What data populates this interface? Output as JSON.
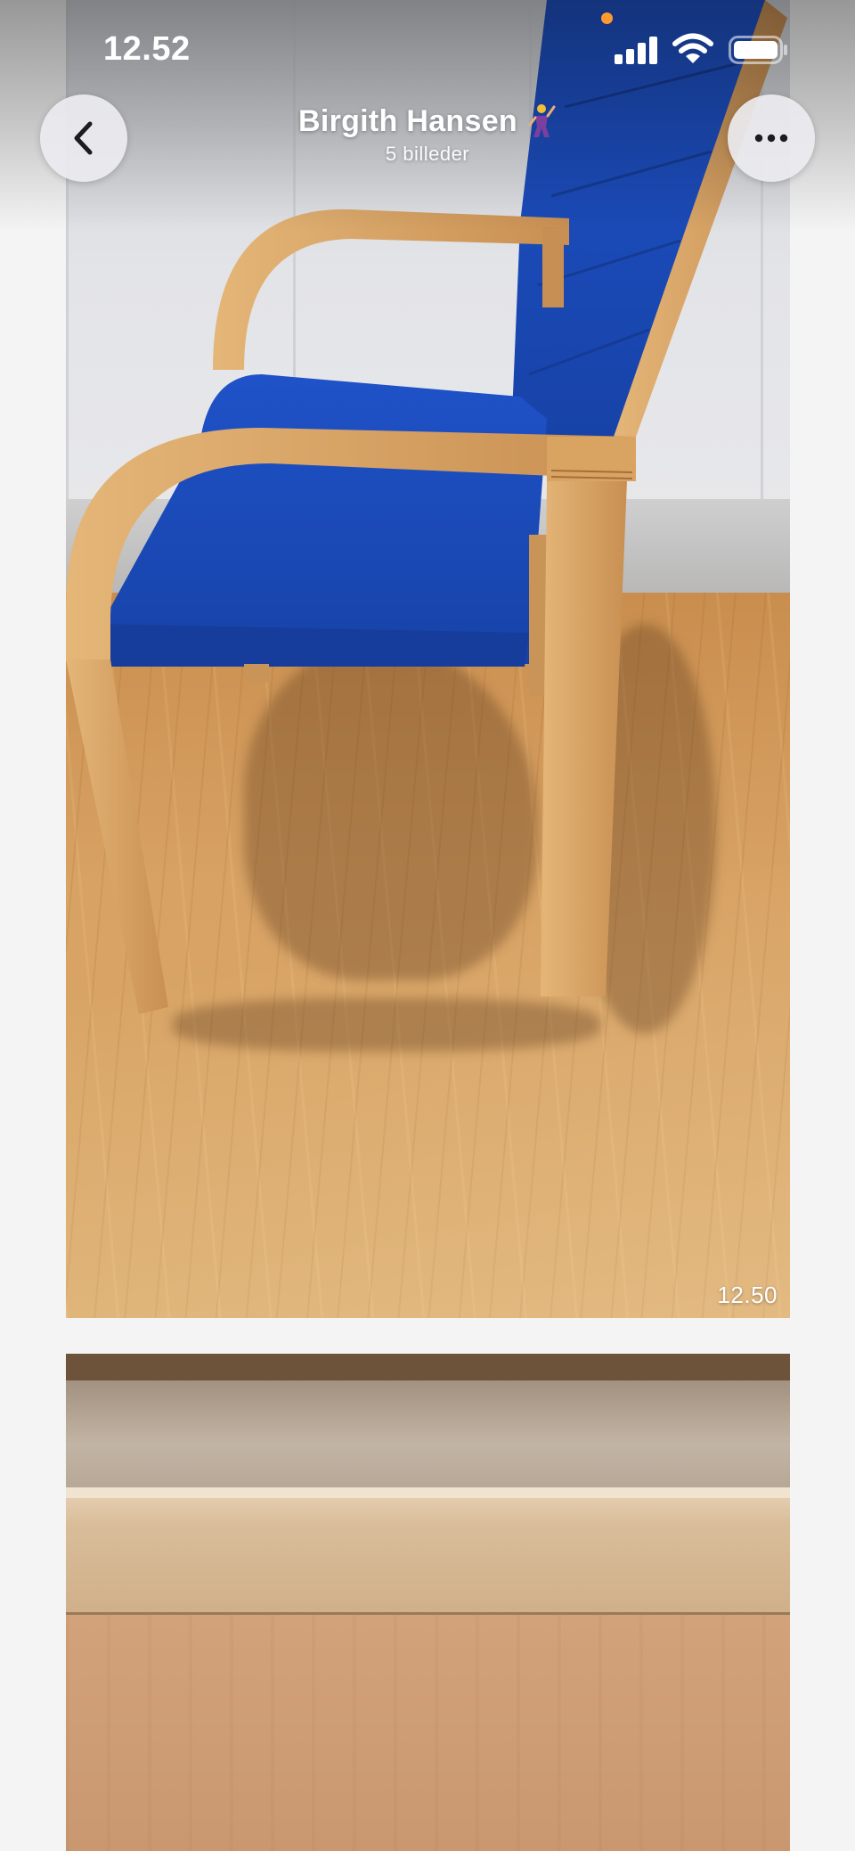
{
  "status_bar": {
    "time": "12.52",
    "signal_icon": "cellular-signal-icon",
    "wifi_icon": "wifi-icon",
    "battery_icon": "battery-icon",
    "recording_indicator": "orange-dot"
  },
  "header": {
    "back_icon": "chevron-left-icon",
    "title": "Birgith Hansen",
    "title_emoji": "dancer-emoji",
    "subtitle": "5 billeder",
    "more_icon": "ellipsis-icon"
  },
  "gallery": {
    "photos": [
      {
        "subject": "chair-photo",
        "timestamp": "12.50"
      },
      {
        "subject": "wood-closeup-photo"
      }
    ]
  },
  "colors": {
    "background": "#f4f4f4",
    "chair_fabric": "#1f4fc0",
    "chair_wood": "#d9a868",
    "button_bg": "#ebecf0",
    "status_dot": "#ff9a2e"
  }
}
